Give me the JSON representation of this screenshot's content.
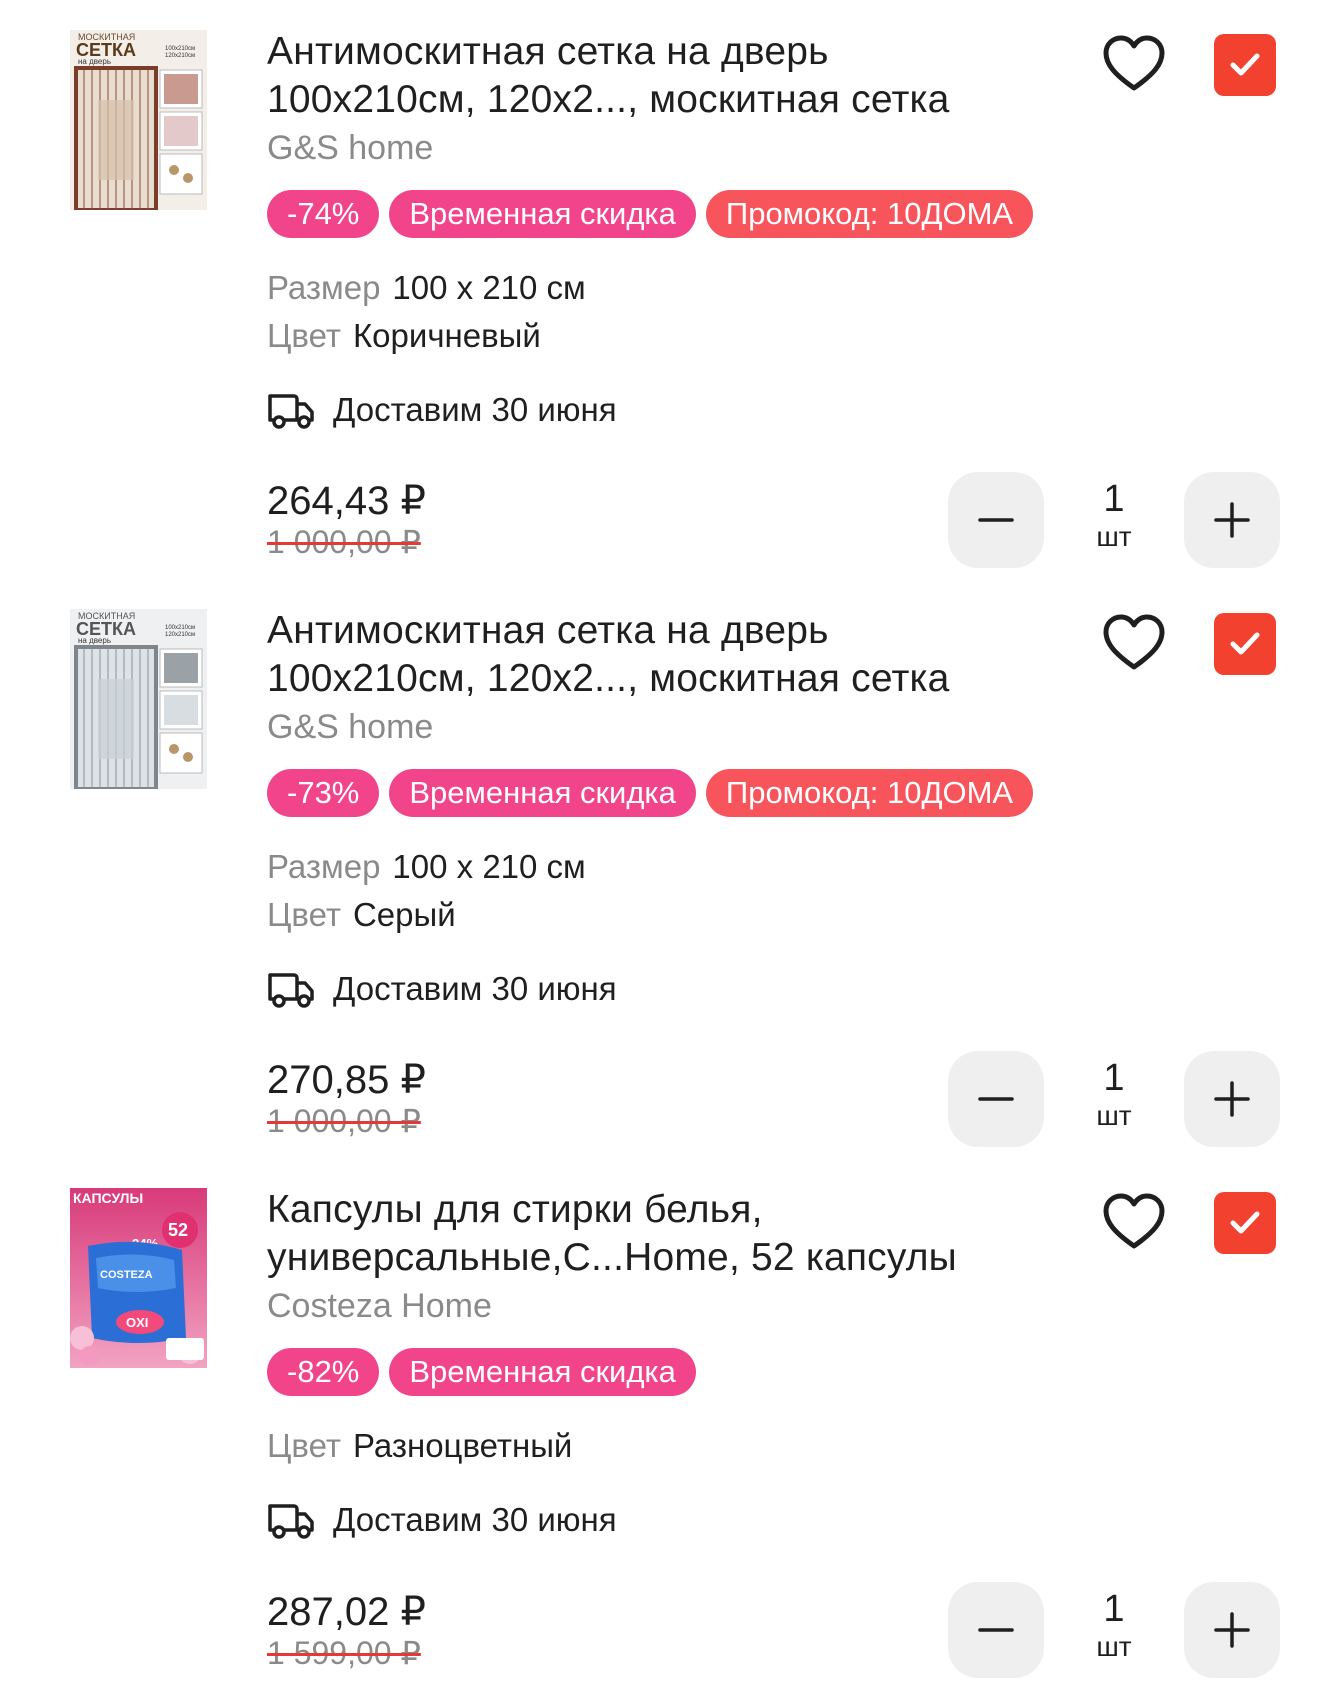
{
  "items": [
    {
      "title_line1": "Антимоскитная сетка на дверь",
      "title_line2": "100х210см, 120х2..., москитная сетка",
      "brand": "G&S home",
      "badge_discount": "-74%",
      "badge_temp": "Временная скидка",
      "badge_promo": "Промокод: 10ДОМА",
      "size_label": "Размер",
      "size_value": "100 x 210 см",
      "color_label": "Цвет",
      "color_value": "Коричневый",
      "delivery": "Доставим 30 июня",
      "price": "264,43 ₽",
      "old_price": "1 000,00 ₽",
      "qty": "1",
      "unit": "шт",
      "image_text_1": "МОСКИТНАЯ",
      "image_text_2": "СЕТКА",
      "image_text_3": "на дверь",
      "image_text_4": "100х210см",
      "image_text_5": "120х210см"
    },
    {
      "title_line1": "Антимоскитная сетка на дверь",
      "title_line2": "100х210см, 120х2..., москитная сетка",
      "brand": "G&S home",
      "badge_discount": "-73%",
      "badge_temp": "Временная скидка",
      "badge_promo": "Промокод: 10ДОМА",
      "size_label": "Размер",
      "size_value": "100 x 210 см",
      "color_label": "Цвет",
      "color_value": "Серый",
      "delivery": "Доставим 30 июня",
      "price": "270,85 ₽",
      "old_price": "1 000,00 ₽",
      "qty": "1",
      "unit": "шт",
      "image_text_1": "МОСКИТНАЯ",
      "image_text_2": "СЕТКА",
      "image_text_3": "на дверь",
      "image_text_4": "100х210см",
      "image_text_5": "120х210см"
    },
    {
      "title_line1": "Капсулы для стирки белья,",
      "title_line2": "универсальные,С...Home, 52 капсулы",
      "brand": "Costeza Home",
      "badge_discount": "-82%",
      "badge_temp": "Временная скидка",
      "color_label": "Цвет",
      "color_value": "Разноцветный",
      "delivery": "Доставим 30 июня",
      "price": "287,02 ₽",
      "old_price": "1 599,00 ₽",
      "qty": "1",
      "unit": "шт",
      "image_text_1": "КАПСУЛЫ",
      "image_text_2": "52",
      "image_text_3": "24%",
      "image_text_4": "COSTEZA",
      "image_text_5": "OXI"
    }
  ],
  "icons": {
    "favorite": "heart-outline-icon",
    "checkbox": "check-icon",
    "delivery": "truck-icon",
    "minus": "minus-icon",
    "plus": "plus-icon"
  },
  "colors": {
    "checkbox": "#f2412f",
    "discount_badge": "#f2448a",
    "promo_badge": "#f7545c",
    "muted_text": "#8a8a8a",
    "stepper_bg": "#efefef"
  }
}
